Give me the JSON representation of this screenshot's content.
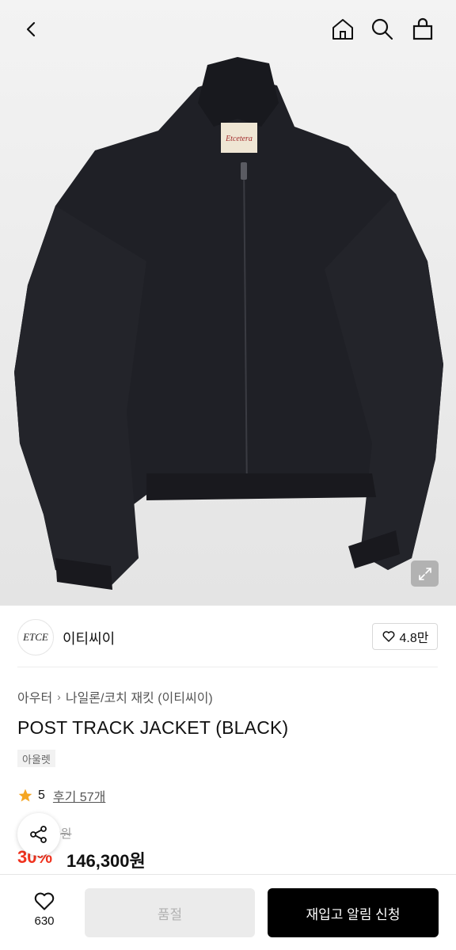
{
  "product_image": {
    "alt": "POST TRACK JACKET (BLACK)"
  },
  "brand": {
    "logo_text": "ETCE",
    "name": "이티씨이",
    "likes": "4.8만"
  },
  "breadcrumb": [
    "아우터",
    "나일론/코치 재킷 (이티씨이)"
  ],
  "product": {
    "title": "POST TRACK JACKET (BLACK)",
    "tag": "아울렛",
    "rating": "5",
    "reviews": "후기 57개",
    "original_price_visible": "00원",
    "discount": "30%",
    "price": "146,300원"
  },
  "bottom_bar": {
    "wish_count": "630",
    "soldout_label": "품절",
    "restock_label": "재입고 알림 신청"
  },
  "colors": {
    "accent_red": "#f0321e",
    "star": "#f5a623",
    "black": "#000000"
  }
}
